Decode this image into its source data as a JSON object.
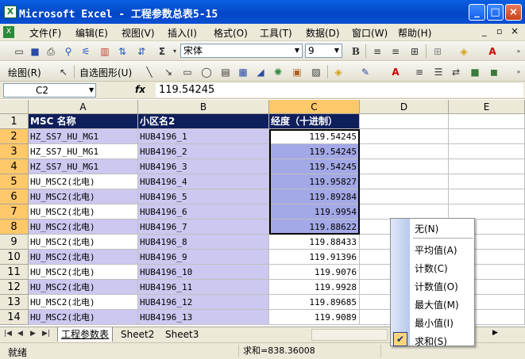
{
  "window": {
    "title": "Microsoft Excel - 工程参数总表5-15",
    "app_icon": "X"
  },
  "menu": [
    "文件(F)",
    "编辑(E)",
    "视图(V)",
    "插入(I)",
    "格式(O)",
    "工具(T)",
    "数据(D)",
    "窗口(W)",
    "帮助(H)"
  ],
  "toolbar": {
    "font_name": "宋体",
    "font_size": "9",
    "bold_label": "B",
    "draw_label": "绘图(R)",
    "autoshape_label": "自选图形(U)"
  },
  "formula_bar": {
    "cell_ref": "C2",
    "fx": "fx",
    "value": "119.54245"
  },
  "columns": [
    "A",
    "B",
    "C",
    "D",
    "E"
  ],
  "headers": [
    "MSC 名称",
    "小区名2",
    "经度（十进制）"
  ],
  "rows": [
    {
      "n": "2",
      "a": "HZ_SS7_HU_MG1",
      "b": "HUB4196_1",
      "c": "119.54245"
    },
    {
      "n": "3",
      "a": "HZ_SS7_HU_MG1",
      "b": "HUB4196_2",
      "c": "119.54245"
    },
    {
      "n": "4",
      "a": "HZ_SS7_HU_MG1",
      "b": "HUB4196_3",
      "c": "119.54245"
    },
    {
      "n": "5",
      "a": "HU_MSC2(北电)",
      "b": "HUB4196_4",
      "c": "119.95827"
    },
    {
      "n": "6",
      "a": "HU_MSC2(北电)",
      "b": "HUB4196_5",
      "c": "119.89284"
    },
    {
      "n": "7",
      "a": "HU_MSC2(北电)",
      "b": "HUB4196_6",
      "c": "119.9954"
    },
    {
      "n": "8",
      "a": "HU_MSC2(北电)",
      "b": "HUB4196_7",
      "c": "119.88622"
    },
    {
      "n": "9",
      "a": "HU_MSC2(北电)",
      "b": "HUB4196_8",
      "c": "119.88433"
    },
    {
      "n": "10",
      "a": "HU_MSC2(北电)",
      "b": "HUB4196_9",
      "c": "119.91396"
    },
    {
      "n": "11",
      "a": "HU_MSC2(北电)",
      "b": "HUB4196_10",
      "c": "119.9076"
    },
    {
      "n": "12",
      "a": "HU_MSC2(北电)",
      "b": "HUB4196_11",
      "c": "119.9928"
    },
    {
      "n": "13",
      "a": "HU_MSC2(北电)",
      "b": "HUB4196_12",
      "c": "119.89685"
    },
    {
      "n": "14",
      "a": "HU_MSC2(北电)",
      "b": "HUB4196_13",
      "c": "119.9089"
    }
  ],
  "sheet_tabs": [
    "工程参数表",
    "Sheet2",
    "Sheet3"
  ],
  "status": {
    "ready": "就绪",
    "sum": "求和=838.36008"
  },
  "popup_menu": {
    "items": [
      "无(N)",
      "平均值(A)",
      "计数(C)",
      "计数值(O)",
      "最大值(M)",
      "最小值(I)",
      "求和(S)"
    ],
    "checked": "求和(S)"
  },
  "colors": {
    "header_bg": "#0f1f5c",
    "row_fill": "#ccc8f0",
    "selection": "#a3a8e6"
  }
}
